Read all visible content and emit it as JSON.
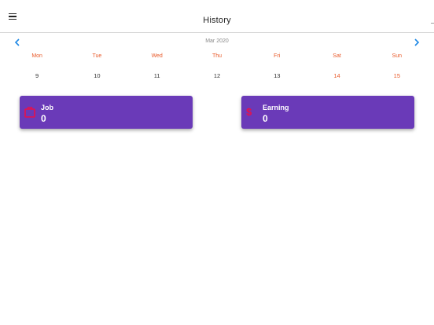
{
  "header": {
    "title": "History",
    "menu_icon": "hamburger-menu-icon"
  },
  "calendar": {
    "month_label": "Mar 2020",
    "prev_icon": "chevron-left-icon",
    "next_icon": "chevron-right-icon",
    "weekdays": [
      "Mon",
      "Tue",
      "Wed",
      "Thu",
      "Fri",
      "Sat",
      "Sun"
    ],
    "dates": [
      "9",
      "10",
      "11",
      "12",
      "13",
      "14",
      "15"
    ]
  },
  "cards": {
    "job": {
      "label": "Job",
      "value": "0",
      "icon": "briefcase-icon"
    },
    "earning": {
      "label": "Earning",
      "value": "0",
      "icon": "dollar-icon"
    }
  },
  "colors": {
    "accent_blue": "#1e88e5",
    "weekday_orange": "#e85a2a",
    "card_purple": "#6a3ab8",
    "icon_red": "#e8104a"
  }
}
